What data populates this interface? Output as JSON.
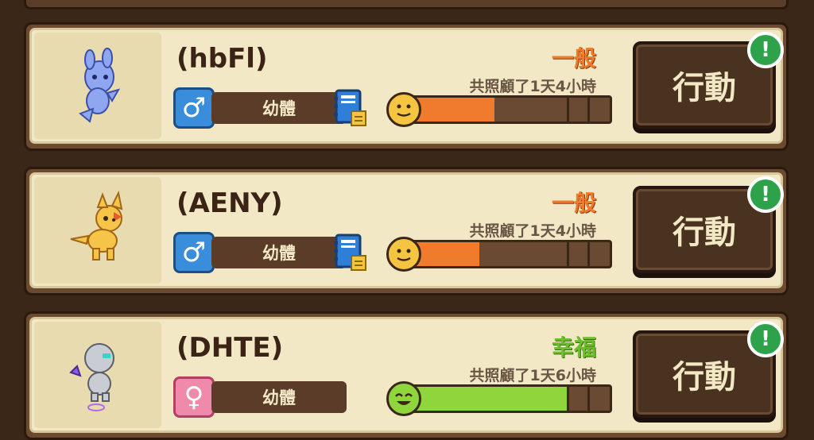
{
  "pets": [
    {
      "name": "(hbFl)",
      "gender": "male",
      "gender_symbol": "♂",
      "stage": "幼體",
      "has_diary": true,
      "mood": "一般",
      "mood_color": "#f07b2c",
      "care_time": "共照顧了1天4小時",
      "happiness": 0.45,
      "bar_color": "#f07b2c",
      "face": "neutral",
      "face_color": "#f5c542",
      "action_label": "行動",
      "alert_symbol": "!"
    },
    {
      "name": "(AENY)",
      "gender": "male",
      "gender_symbol": "♂",
      "stage": "幼體",
      "has_diary": true,
      "mood": "一般",
      "mood_color": "#f07b2c",
      "care_time": "共照顧了1天4小時",
      "happiness": 0.38,
      "bar_color": "#f07b2c",
      "face": "neutral",
      "face_color": "#f5c542",
      "action_label": "行動",
      "alert_symbol": "!"
    },
    {
      "name": "(DHTE)",
      "gender": "female",
      "gender_symbol": "♀",
      "stage": "幼體",
      "has_diary": false,
      "mood": "幸福",
      "mood_color": "#6cbf2a",
      "care_time": "共照顧了1天6小時",
      "happiness": 0.8,
      "bar_color": "#8fd63c",
      "face": "happy",
      "face_color": "#8fd63c",
      "action_label": "行動",
      "alert_symbol": "!"
    }
  ]
}
